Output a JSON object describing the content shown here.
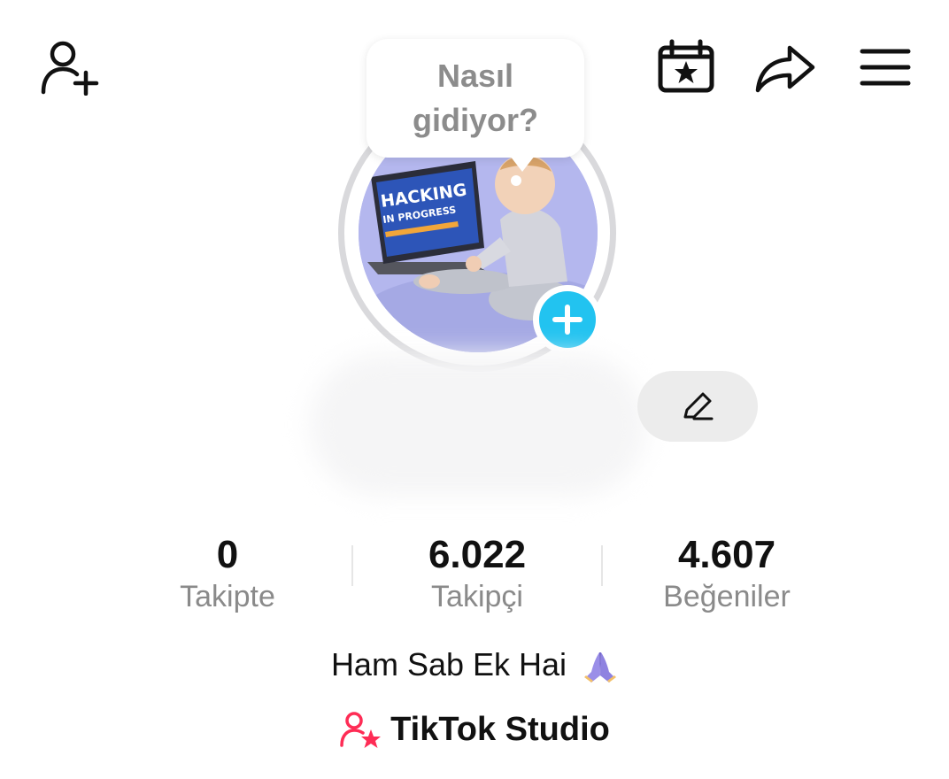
{
  "header": {
    "add_friend_icon": "person-plus-icon",
    "calendar_icon": "calendar-star-icon",
    "share_icon": "share-arrow-icon",
    "menu_icon": "hamburger-menu-icon"
  },
  "profile": {
    "avatar_text_line1": "HACKING",
    "avatar_text_line2": "IN PROGRESS",
    "bubble_text": "Nasıl gidiyor?",
    "add_story_icon": "plus-icon",
    "edit_icon": "pencil-icon"
  },
  "stats": [
    {
      "value": "0",
      "label": "Takipte"
    },
    {
      "value": "6.022",
      "label": "Takipçi"
    },
    {
      "value": "4.607",
      "label": "Beğeniler"
    }
  ],
  "bio": {
    "text": "Ham Sab Ek Hai",
    "emoji_icon": "folded-hands-icon"
  },
  "studio": {
    "label": "TikTok Studio",
    "icon": "person-star-icon",
    "accent_color": "#fe2c55"
  },
  "colors": {
    "story_plus": "#22c3f0",
    "muted_text": "#8a8a8a"
  }
}
